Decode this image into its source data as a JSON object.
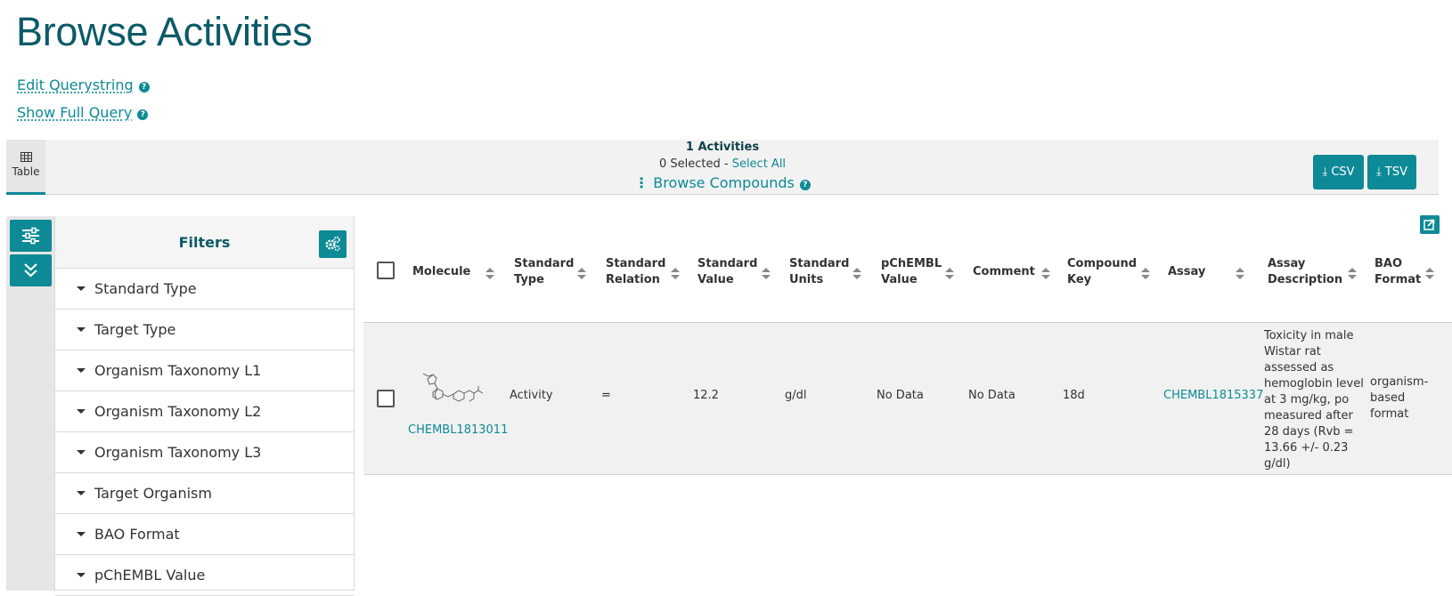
{
  "page": {
    "title": "Browse Activities",
    "edit_querystring": "Edit Querystring",
    "show_full_query": "Show Full Query",
    "help_glyph": "?"
  },
  "toolbar": {
    "tab_label": "Table",
    "activities_count": "1 Activities",
    "selected_text": "0 Selected -",
    "select_all": "Select All",
    "browse_compounds": "Browse Compounds",
    "csv_label": "CSV",
    "tsv_label": "TSV"
  },
  "filters": {
    "title": "Filters",
    "items": [
      "Standard Type",
      "Target Type",
      "Organism Taxonomy L1",
      "Organism Taxonomy L2",
      "Organism Taxonomy L3",
      "Target Organism",
      "BAO Format",
      "pChEMBL Value"
    ]
  },
  "table": {
    "columns": [
      {
        "line1": "Molecule",
        "line2": ""
      },
      {
        "line1": "Standard",
        "line2": "Type"
      },
      {
        "line1": "Standard",
        "line2": "Relation"
      },
      {
        "line1": "Standard",
        "line2": "Value"
      },
      {
        "line1": "Standard",
        "line2": "Units"
      },
      {
        "line1": "pChEMBL",
        "line2": "Value"
      },
      {
        "line1": "Comment",
        "line2": ""
      },
      {
        "line1": "Compound",
        "line2": "Key"
      },
      {
        "line1": "Assay",
        "line2": ""
      },
      {
        "line1": "Assay",
        "line2": "Description"
      },
      {
        "line1": "BAO",
        "line2": "Format"
      }
    ],
    "row": {
      "molecule_id": "CHEMBL1813011",
      "standard_type": "Activity",
      "standard_relation": "=",
      "standard_value": "12.2",
      "standard_units": "g/dl",
      "pchembl_value": "No Data",
      "comment": "No Data",
      "compound_key": "18d",
      "assay": "CHEMBL1815337",
      "assay_description_lines": [
        "Toxicity in male",
        "Wistar rat",
        "assessed as",
        "hemoglobin level",
        "at 3 mg/kg, po",
        "measured after",
        "28 days (Rvb =",
        "13.66 +/- 0.23",
        "g/dl)"
      ],
      "bao_format_lines": [
        "organism-",
        "based",
        "format"
      ]
    }
  },
  "colors": {
    "accent": "#0d8a96",
    "title": "#0d5a67",
    "toolbar_bg": "#f2f2f2",
    "row_bg": "#f1f1f1"
  },
  "icons": {
    "tab": "table-grid-icon",
    "browse": "vertical-ellipsis-icon",
    "download": "download-icon",
    "rail_top": "sliders-icon",
    "rail_bottom": "double-chevron-down-icon",
    "filters_gear": "gears-icon",
    "share": "share-icon"
  }
}
